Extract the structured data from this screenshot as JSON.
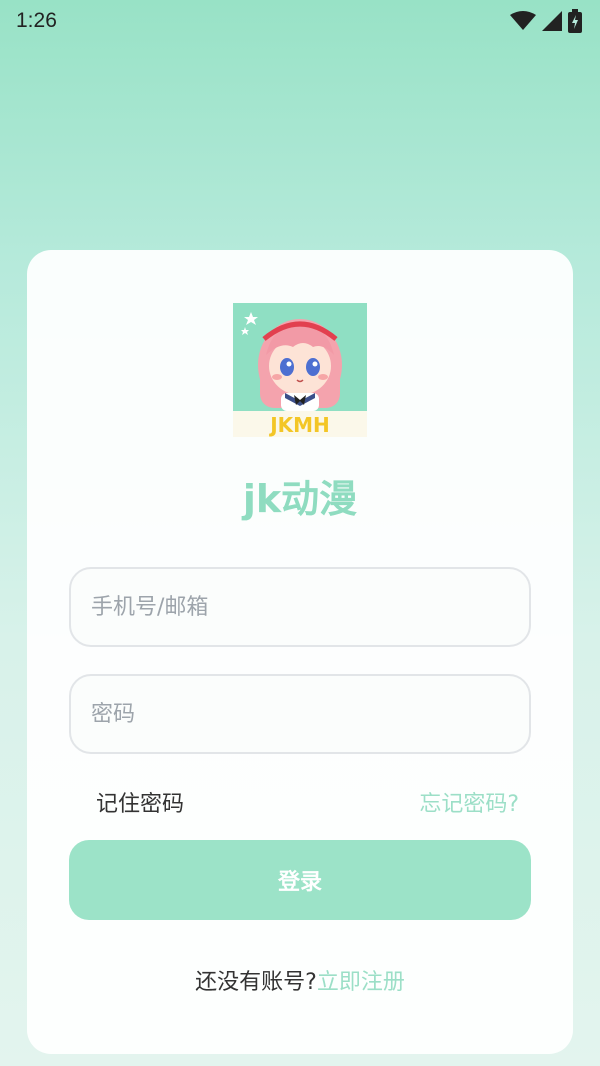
{
  "status_bar": {
    "time": "1:26",
    "icons": [
      "wifi-icon",
      "cell-signal-icon",
      "battery-charging-icon"
    ]
  },
  "logo": {
    "text": "JKMH"
  },
  "app_name": "jk动漫",
  "form": {
    "username_placeholder": "手机号/邮箱",
    "password_placeholder": "密码",
    "remember_label": "记住密码",
    "forgot_label": "忘记密码?",
    "login_label": "登录",
    "signup_prompt": "还没有账号?",
    "signup_link": "立即注册"
  },
  "colors": {
    "accent": "#9ce3c8",
    "accent_text": "#8fdcc0",
    "background_top": "#98e2c6"
  }
}
